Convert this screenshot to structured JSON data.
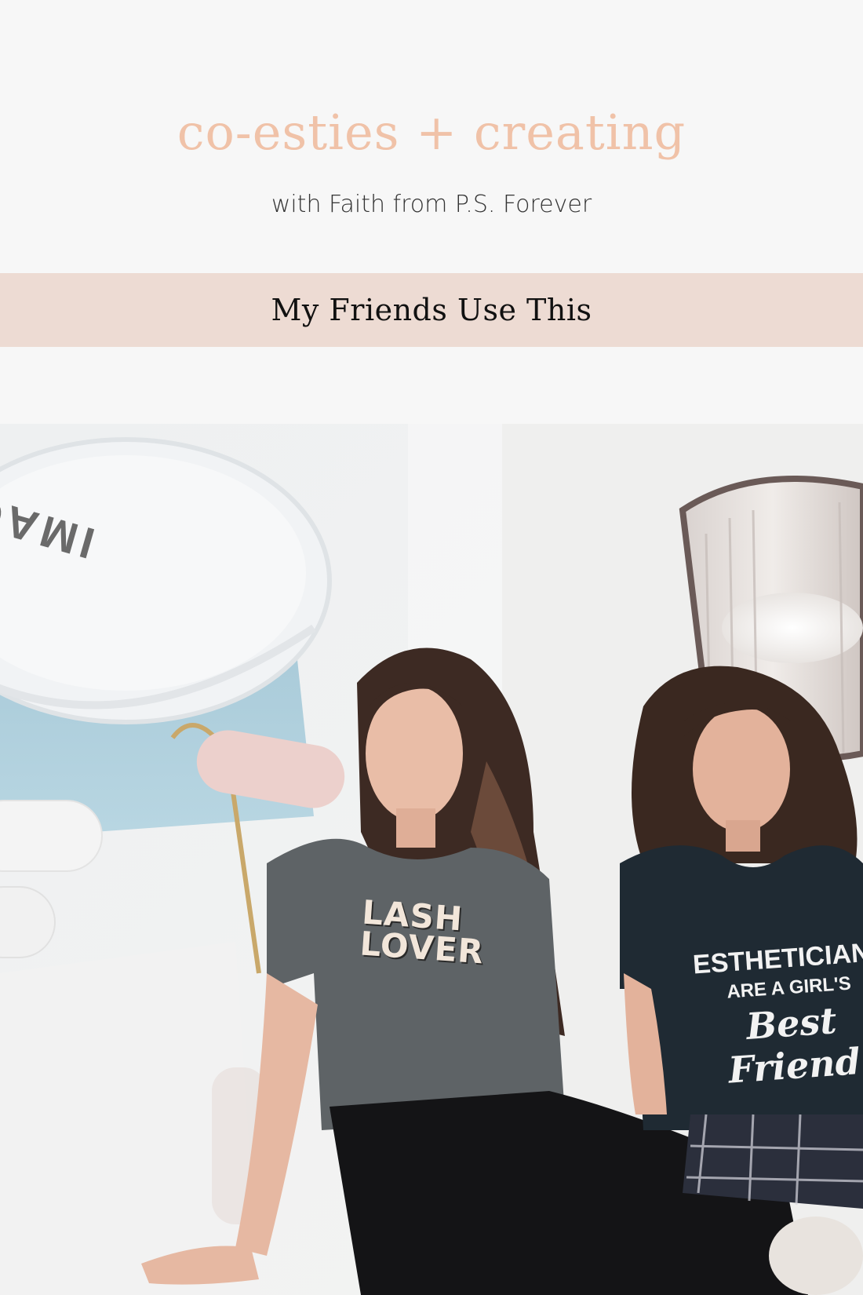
{
  "header": {
    "title": "co-esties + creating",
    "subtitle": "with Faith from P.S. Forever"
  },
  "banner": {
    "text": "My Friends Use This"
  },
  "photo": {
    "jar_brand": "IMAGE SKIN",
    "shirt_left_text": "LASH\nLOVER",
    "shirt_right_line1": "ESTHETICIANS",
    "shirt_right_line2": "ARE A GIRL'S",
    "shirt_right_line3": "Best Friend"
  },
  "colors": {
    "background": "#f7f7f7",
    "title": "#f0c2a8",
    "banner": "#eddbd3"
  }
}
